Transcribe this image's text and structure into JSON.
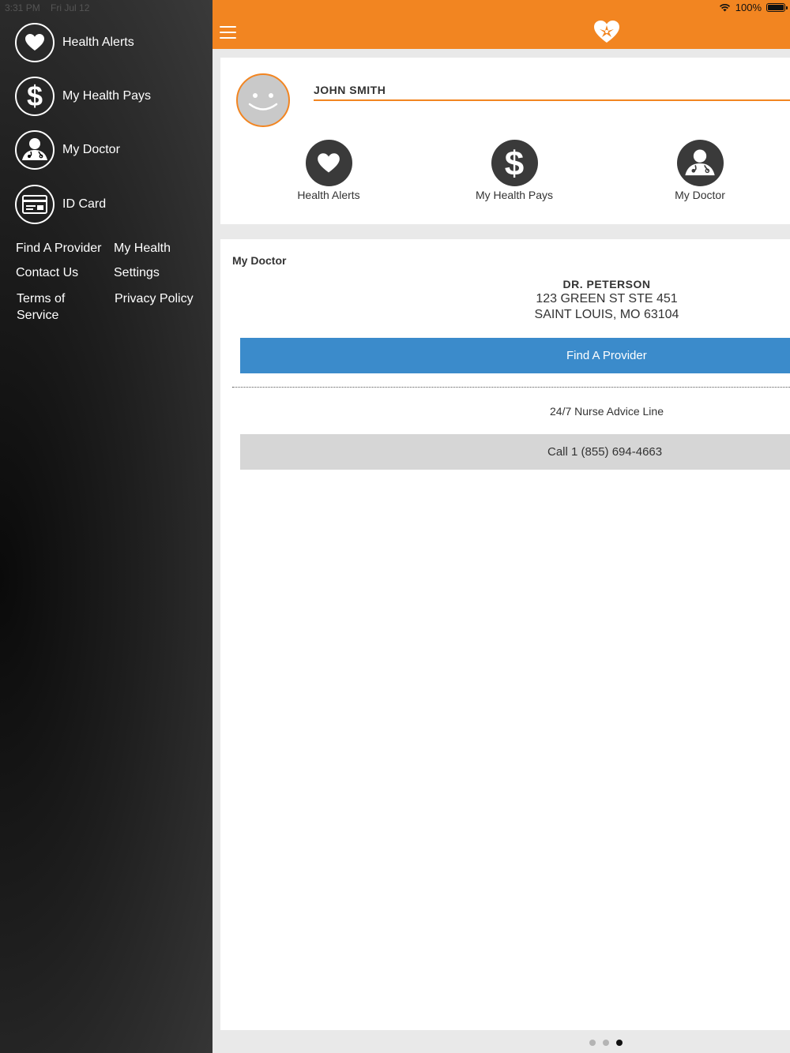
{
  "status_bar": {
    "time": "3:31 PM",
    "date": "Fri Jul 12",
    "battery": "100%"
  },
  "sidebar": {
    "items": [
      {
        "label": "Health Alerts",
        "icon": "heart-icon"
      },
      {
        "label": "My Health Pays",
        "icon": "dollar-icon"
      },
      {
        "label": "My Doctor",
        "icon": "doctor-icon"
      },
      {
        "label": "ID Card",
        "icon": "id-card-icon"
      }
    ],
    "links": {
      "find_provider": "Find A Provider",
      "my_health": "My Health",
      "contact_us": "Contact Us",
      "settings": "Settings",
      "terms_1": "Terms of",
      "terms_2": "Service",
      "privacy": "Privacy Policy"
    }
  },
  "header": {
    "accent_color": "#f28521",
    "logo": "heart-logo-icon"
  },
  "profile": {
    "name": "JOHN SMITH",
    "quick_links": [
      {
        "label": "Health Alerts",
        "icon": "heart-icon"
      },
      {
        "label": "My Health Pays",
        "icon": "dollar-icon"
      },
      {
        "label": "My Doctor",
        "icon": "doctor-icon"
      }
    ]
  },
  "doctor": {
    "section_title": "My Doctor",
    "name": "DR. PETERSON",
    "address_line1": "123 GREEN ST STE 451",
    "address_line2": "SAINT LOUIS, MO 63104",
    "find_provider_button": "Find A Provider",
    "nurse_line_label": "24/7 Nurse Advice Line",
    "call_button": "Call 1 (855) 694-4663"
  },
  "pager": {
    "pages": 3,
    "current": 3
  }
}
